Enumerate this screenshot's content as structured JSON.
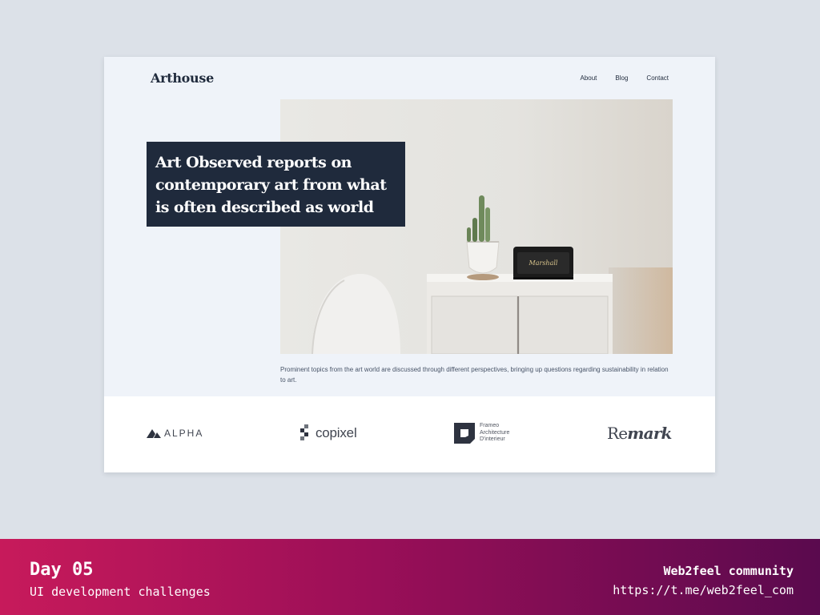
{
  "site": {
    "brand": "Arthouse",
    "nav": [
      {
        "label": "About"
      },
      {
        "label": "Blog"
      },
      {
        "label": "Contact"
      }
    ]
  },
  "hero": {
    "headline": "Art Observed reports on contemporary art from what is often described as world",
    "caption": "Prominent topics from the art world are discussed through different perspectives, bringing up questions regarding sustainability in relation to art.",
    "speaker_brand": "Marshall"
  },
  "logos": {
    "alpha": "ALPHA",
    "copixel": "copixel",
    "frameo": [
      "Frameo",
      "Architecture",
      "D'interieur"
    ],
    "remark_regular": "Re",
    "remark_bold": "mark"
  },
  "footer": {
    "day": "Day 05",
    "subtitle": "UI development challenges",
    "community": "Web2feel community",
    "url": "https://t.me/web2feel_com"
  },
  "colors": {
    "background": "#dce1e8",
    "card": "#eff3f9",
    "navy": "#1f2a3c",
    "footer_start": "#c71a5b",
    "footer_end": "#5a0a4e"
  }
}
